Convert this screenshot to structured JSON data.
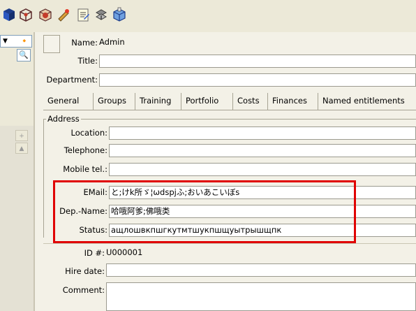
{
  "toolbar": {
    "icons": [
      "blue-cube-icon",
      "3d-box-icon",
      "red-box-icon",
      "pencil-icon",
      "notepad-icon",
      "connector-icon",
      "blue-box-icon"
    ]
  },
  "form": {
    "name_label": "Name:",
    "name_value": "Admin",
    "title_label": "Title:",
    "title_value": "",
    "department_label": "Department:",
    "department_value": ""
  },
  "tabs": [
    "General",
    "Groups",
    "Training",
    "Portfolio",
    "Costs",
    "Finances",
    "Named entitlements"
  ],
  "address": {
    "group_title": "Address",
    "location_label": "Location:",
    "location_value": "",
    "telephone_label": "Telephone:",
    "telephone_value": "",
    "mobile_label": "Mobile tel.:",
    "mobile_value": "",
    "email_label": "EMail:",
    "email_value": "と;けk所ゞ¦ωdspjふ;おいあこいぼs",
    "depname_label": "Dep.-Name:",
    "depname_value": "哈哦阿爹;佛哦类",
    "status_label": "Status:",
    "status_value": "ащлошвкпшгкутмтшукпшщуытрышщпк"
  },
  "other": {
    "id_label": "ID #:",
    "id_value": "U000001",
    "hire_label": "Hire date:",
    "hire_value": "",
    "comment_label": "Comment:",
    "comment_value": ""
  },
  "colors": {
    "highlight": "#e00000",
    "background": "#ece9d8",
    "panel": "#f3f1e7"
  }
}
